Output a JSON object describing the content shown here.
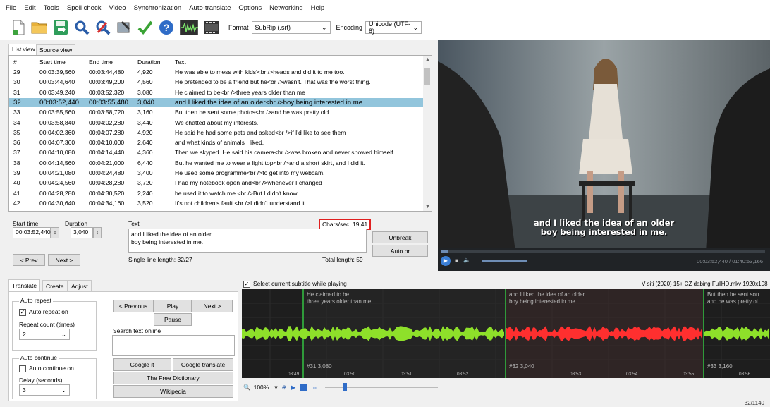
{
  "menu": [
    "File",
    "Edit",
    "Tools",
    "Spell check",
    "Video",
    "Synchronization",
    "Auto-translate",
    "Options",
    "Networking",
    "Help"
  ],
  "toolbar": {
    "format_label": "Format",
    "format_value": "SubRip (.srt)",
    "encoding_label": "Encoding",
    "encoding_value": "Unicode (UTF-8)",
    "icons": [
      "new-icon",
      "open-icon",
      "save-icon",
      "find-icon",
      "replace-icon",
      "fix-icon",
      "spellcheck-icon",
      "help-icon",
      "waveform-icon",
      "video-icon"
    ]
  },
  "tabs": {
    "list_view": "List view",
    "source_view": "Source view"
  },
  "list": {
    "headers": [
      "#",
      "Start time",
      "End time",
      "Duration",
      "Text"
    ],
    "rows": [
      [
        "29",
        "00:03:39,560",
        "00:03:44,480",
        "4,920",
        "He was able to mess with kids'<br />heads and did it to me too."
      ],
      [
        "30",
        "00:03:44,640",
        "00:03:49,200",
        "4,560",
        "He pretended to be a friend but he<br />wasn't. That was the worst thing."
      ],
      [
        "31",
        "00:03:49,240",
        "00:03:52,320",
        "3,080",
        "He claimed to be<br />three years older than me"
      ],
      [
        "32",
        "00:03:52,440",
        "00:03:55,480",
        "3,040",
        "and I liked the idea of an older<br />boy being interested in me."
      ],
      [
        "33",
        "00:03:55,560",
        "00:03:58,720",
        "3,160",
        "But then he sent some photos<br />and he was pretty old."
      ],
      [
        "34",
        "00:03:58,840",
        "00:04:02,280",
        "3,440",
        "We chatted about my interests."
      ],
      [
        "35",
        "00:04:02,360",
        "00:04:07,280",
        "4,920",
        "He said he had some pets and asked<br />if I'd like to see them"
      ],
      [
        "36",
        "00:04:07,360",
        "00:04:10,000",
        "2,640",
        "and what kinds of animals I liked."
      ],
      [
        "37",
        "00:04:10,080",
        "00:04:14,440",
        "4,360",
        "Then we skyped. He said his camera<br />was broken and never showed himself."
      ],
      [
        "38",
        "00:04:14,560",
        "00:04:21,000",
        "6,440",
        "But he wanted me to wear a light top<br />and a short skirt, and I did it."
      ],
      [
        "39",
        "00:04:21,080",
        "00:04:24,480",
        "3,400",
        "He used some programme<br />to get into my webcam."
      ],
      [
        "40",
        "00:04:24,560",
        "00:04:28,280",
        "3,720",
        "I had my notebook open and<br />whenever I changed"
      ],
      [
        "41",
        "00:04:28,280",
        "00:04:30,520",
        "2,240",
        "he used it to watch me.<br />But I didn't know."
      ],
      [
        "42",
        "00:04:30,640",
        "00:04:34,160",
        "3,520",
        "It's not children's fault.<br />I didn't understand it."
      ]
    ],
    "selected_index": 3
  },
  "edit": {
    "start_label": "Start time",
    "start_value": "00:03:52,440",
    "duration_label": "Duration",
    "duration_value": "3,040",
    "text_label": "Text",
    "chars_sec": "Chars/sec: 19,41",
    "text_line1": "and I liked the idea of an older",
    "text_line2": "boy being interested in me.",
    "unbreak": "Unbreak",
    "auto_br": "Auto br",
    "prev": "< Prev",
    "next": "Next >",
    "single_line": "Single line length: 32/27",
    "total_length": "Total length: 59"
  },
  "video": {
    "subtitle_line1": "and I liked the idea of an older",
    "subtitle_line2": "boy being interested in me.",
    "timecode": "00:03:52,440 / 01:40:53,166"
  },
  "bottom_tabs": [
    "Translate",
    "Create",
    "Adjust"
  ],
  "translate": {
    "auto_repeat_title": "Auto repeat",
    "auto_repeat_on": "Auto repeat on",
    "repeat_count_label": "Repeat count (times)",
    "repeat_count_value": "2",
    "auto_continue_title": "Auto continue",
    "auto_continue_on": "Auto continue on",
    "delay_label": "Delay (seconds)",
    "delay_value": "3",
    "previous": "< Previous",
    "play": "Play",
    "next": "Next >",
    "pause": "Pause",
    "search_online": "Search text online",
    "google_it": "Google it",
    "google_translate": "Google translate",
    "free_dictionary": "The Free Dictionary",
    "wikipedia": "Wikipedia"
  },
  "waveform": {
    "select_current": "Select current subtitle while playing",
    "file_title": "V siti (2020) 15+ CZ dabing FullHD.mkv 1920x108",
    "seg_prev_line1": "He claimed to be",
    "seg_prev_line2": "three years older than me",
    "seg_cur_line1": "and I liked the idea of an older",
    "seg_cur_line2": "boy being interested in me.",
    "seg_next_line1": "But then he sent son",
    "seg_next_line2": "and he was pretty ol",
    "label_31": "#31  3,080",
    "label_32": "#32  3,040",
    "label_33": "#33  3,160",
    "ticks": [
      "03:49",
      "03:50",
      "03:51",
      "03:52",
      "03:53",
      "03:54",
      "03:55",
      "03:56"
    ],
    "zoom": "100%"
  },
  "status": "32/1140",
  "colors": {
    "selected_row": "#92c5dc",
    "wave_green": "#8ee02a",
    "wave_red": "#ff2f2f",
    "highlight_box": "#e02020"
  }
}
